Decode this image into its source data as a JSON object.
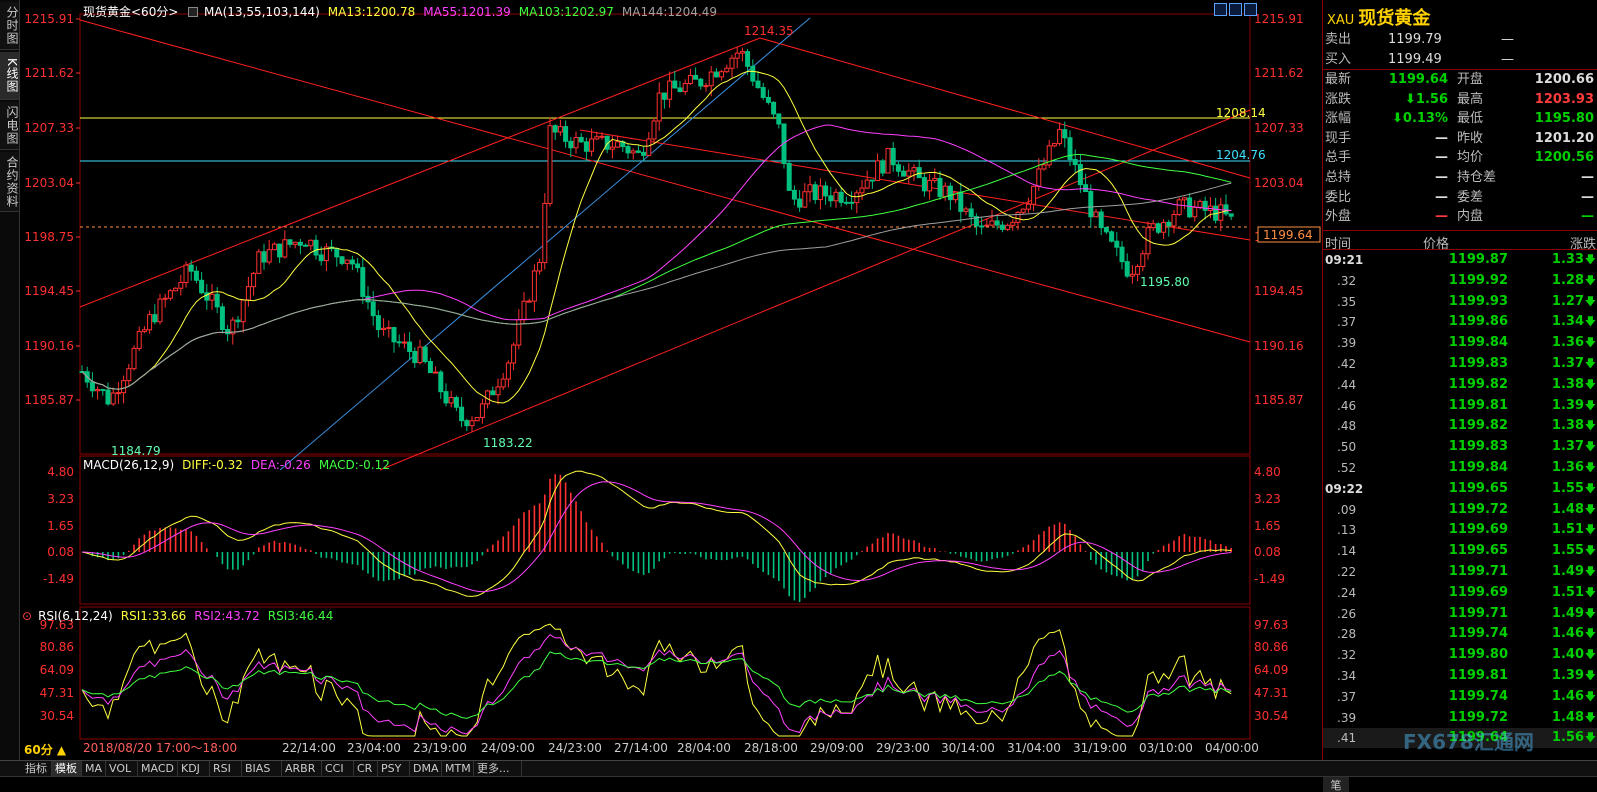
{
  "left_nav": [
    "分时图",
    "K线图",
    "闪电图",
    "合约资料"
  ],
  "left_nav_active": 1,
  "chart_title": "现货黄金<60分>",
  "ma_legend": [
    {
      "text": "MA(13,55,103,144)",
      "color": "#ffffff"
    },
    {
      "text": "MA13:1200.78",
      "color": "#ffff40"
    },
    {
      "text": "MA55:1201.39",
      "color": "#ff40ff"
    },
    {
      "text": "MA103:1202.97",
      "color": "#40ff40"
    },
    {
      "text": "MA144:1204.49",
      "color": "#a0a0a0"
    }
  ],
  "macd_legend": [
    {
      "text": "MACD(26,12,9)",
      "color": "#ffffff"
    },
    {
      "text": "DIFF:-0.32",
      "color": "#ffff40"
    },
    {
      "text": "DEA:-0.26",
      "color": "#ff40ff"
    },
    {
      "text": "MACD:-0.12",
      "color": "#40ff40"
    }
  ],
  "rsi_legend": [
    {
      "text": "RSI(6,12,24)",
      "color": "#ffffff"
    },
    {
      "text": "RSI1:33.66",
      "color": "#ffff40"
    },
    {
      "text": "RSI2:43.72",
      "color": "#ff40ff"
    },
    {
      "text": "RSI3:46.44",
      "color": "#40ff40"
    }
  ],
  "price_axis": [
    "1215.91",
    "1211.62",
    "1207.33",
    "1203.04",
    "1198.75",
    "1194.45",
    "1190.16",
    "1185.87"
  ],
  "macd_axis": [
    "4.80",
    "3.23",
    "1.65",
    "0.08",
    "-1.49"
  ],
  "rsi_axis": [
    "97.63",
    "80.86",
    "64.09",
    "47.31",
    "30.54"
  ],
  "annotations": {
    "high": "1214.35",
    "low1": "1184.79",
    "low2": "1183.22",
    "low3": "1195.80",
    "level1": "1208.14",
    "level2": "1204.76",
    "current": "1199.64"
  },
  "x_axis": [
    "2018/08/20 17:00～18:00",
    "22/14:00",
    "23/04:00",
    "23/19:00",
    "24/09:00",
    "24/23:00",
    "27/14:00",
    "28/04:00",
    "28/18:00",
    "29/09:00",
    "29/23:00",
    "30/14:00",
    "31/04:00",
    "31/19:00",
    "03/10:00",
    "04/00:00"
  ],
  "period": "60分 ▲",
  "bottom_tabs": [
    "指标",
    "模板",
    "MA",
    "VOL",
    "MACD",
    "KDJ",
    "RSI",
    "BIAS",
    "ARBR",
    "CCI",
    "CR",
    "PSY",
    "DMA",
    "MTM",
    "更多..."
  ],
  "colors": {
    "up": "#ff3030",
    "down": "#00c080",
    "ma13": "#ffff40",
    "ma55": "#ff40ff",
    "ma103": "#40ff40",
    "ma144": "#a0a0a0",
    "axis_red": "#ff3030"
  },
  "quote": {
    "code": "XAU",
    "name": "现货黄金",
    "sell_label": "卖出",
    "sell": "1199.79",
    "sell_vol": "—",
    "buy_label": "买入",
    "buy": "1199.49",
    "buy_vol": "—",
    "rows": [
      {
        "l1": "最新",
        "v1": "1199.64",
        "c1": "green",
        "l2": "开盘",
        "v2": "1200.66",
        "c2": "white"
      },
      {
        "l1": "涨跌",
        "v1": "⬇1.56",
        "c1": "green",
        "l2": "最高",
        "v2": "1203.93",
        "c2": "red"
      },
      {
        "l1": "涨幅",
        "v1": "⬇0.13%",
        "c1": "green",
        "l2": "最低",
        "v2": "1195.80",
        "c2": "green"
      },
      {
        "l1": "现手",
        "v1": "—",
        "c1": "white",
        "l2": "昨收",
        "v2": "1201.20",
        "c2": "white"
      },
      {
        "l1": "总手",
        "v1": "—",
        "c1": "white",
        "l2": "均价",
        "v2": "1200.56",
        "c2": "green"
      },
      {
        "l1": "总持",
        "v1": "—",
        "c1": "white",
        "l2": "持仓差",
        "v2": "—",
        "c2": "white"
      },
      {
        "l1": "委比",
        "v1": "—",
        "c1": "white",
        "l2": "委差",
        "v2": "—",
        "c2": "white"
      },
      {
        "l1": "外盘",
        "v1": "—",
        "c1": "red",
        "l2": "内盘",
        "v2": "—",
        "c2": "green"
      }
    ],
    "tick_headers": [
      "时间",
      "价格",
      "涨跌"
    ],
    "ticks": [
      {
        "t": "09:21",
        "p": "1199.87",
        "c": "1.33"
      },
      {
        "t": ".32",
        "p": "1199.92",
        "c": "1.28"
      },
      {
        "t": ".35",
        "p": "1199.93",
        "c": "1.27"
      },
      {
        "t": ".37",
        "p": "1199.86",
        "c": "1.34"
      },
      {
        "t": ".39",
        "p": "1199.84",
        "c": "1.36"
      },
      {
        "t": ".42",
        "p": "1199.83",
        "c": "1.37"
      },
      {
        "t": ".44",
        "p": "1199.82",
        "c": "1.38"
      },
      {
        "t": ".46",
        "p": "1199.81",
        "c": "1.39"
      },
      {
        "t": ".48",
        "p": "1199.82",
        "c": "1.38"
      },
      {
        "t": ".50",
        "p": "1199.83",
        "c": "1.37"
      },
      {
        "t": ".52",
        "p": "1199.84",
        "c": "1.36"
      },
      {
        "t": "09:22",
        "p": "1199.65",
        "c": "1.55"
      },
      {
        "t": ".09",
        "p": "1199.72",
        "c": "1.48"
      },
      {
        "t": ".13",
        "p": "1199.69",
        "c": "1.51"
      },
      {
        "t": ".14",
        "p": "1199.65",
        "c": "1.55"
      },
      {
        "t": ".22",
        "p": "1199.71",
        "c": "1.49"
      },
      {
        "t": ".24",
        "p": "1199.69",
        "c": "1.51"
      },
      {
        "t": ".26",
        "p": "1199.71",
        "c": "1.49"
      },
      {
        "t": ".28",
        "p": "1199.74",
        "c": "1.46"
      },
      {
        "t": ".32",
        "p": "1199.80",
        "c": "1.40"
      },
      {
        "t": ".34",
        "p": "1199.81",
        "c": "1.39"
      },
      {
        "t": ".37",
        "p": "1199.74",
        "c": "1.46"
      },
      {
        "t": ".39",
        "p": "1199.72",
        "c": "1.48"
      },
      {
        "t": ".41",
        "p": "1199.64",
        "c": "1.56"
      }
    ],
    "panel_tab": "笔"
  },
  "watermark": "FX678汇通网"
}
